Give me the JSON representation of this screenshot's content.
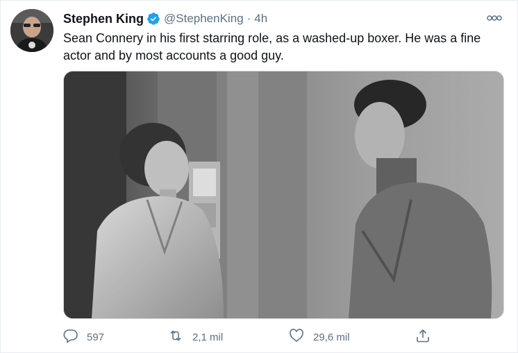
{
  "tweet": {
    "author_name": "Stephen King",
    "handle": "@StephenKing",
    "separator": "·",
    "timestamp": "4h",
    "text": "Sean Connery in his first starring role, as a washed-up boxer. He was a fine actor and by most accounts a good guy."
  },
  "icons": {
    "verified": "verified-badge-icon",
    "more": "more-options-icon",
    "reply": "reply-icon",
    "retweet": "retweet-icon",
    "like": "like-icon",
    "share": "share-icon"
  },
  "actions": {
    "reply_count": "597",
    "retweet_count": "2,1 mil",
    "like_count": "29,6 mil"
  },
  "colors": {
    "verified": "#1da1f2",
    "secondary_text": "#5b7083",
    "primary_text": "#0f1419"
  }
}
